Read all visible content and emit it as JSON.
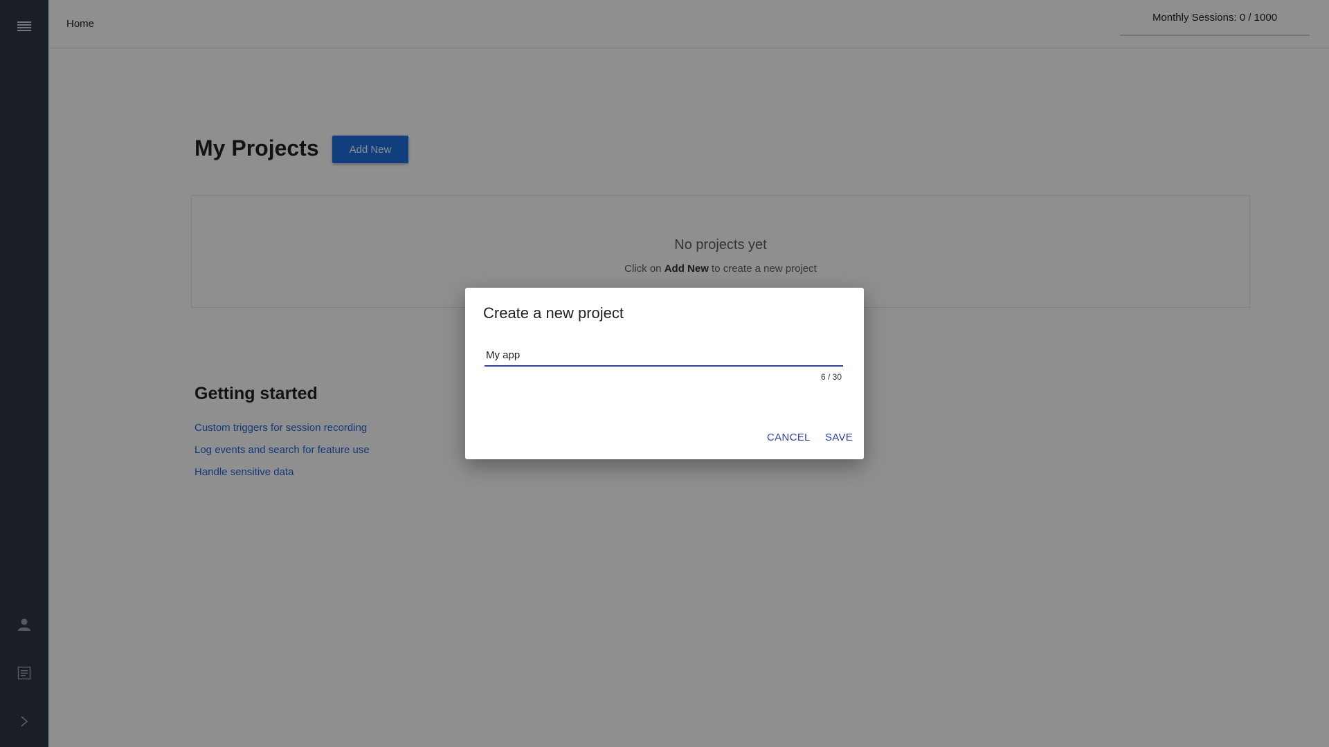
{
  "header": {
    "breadcrumb": "Home",
    "sessions": "Monthly Sessions: 0 / 1000"
  },
  "projects": {
    "title": "My Projects",
    "add_label": "Add New",
    "empty_title": "No projects yet",
    "empty_prefix": "Click on",
    "empty_bold": "Add New",
    "empty_suffix": "to create a new project"
  },
  "getting_started": {
    "title": "Getting started",
    "links": [
      "Custom triggers for session recording",
      "Log events and search for feature use",
      "Handle sensitive data"
    ]
  },
  "dialog": {
    "title": "Create a new project",
    "input_value": "My app",
    "counter": "6 / 30",
    "cancel_label": "CANCEL",
    "save_label": "SAVE"
  },
  "sidebar": {
    "icons": [
      "list-icon",
      "user-icon",
      "document-icon",
      "chevron-right-icon"
    ]
  },
  "colors": {
    "sidebar": "#2f3642",
    "primary": "#1f6fde",
    "dialog_accent": "#2d3fb8",
    "link": "#1d68d6"
  }
}
